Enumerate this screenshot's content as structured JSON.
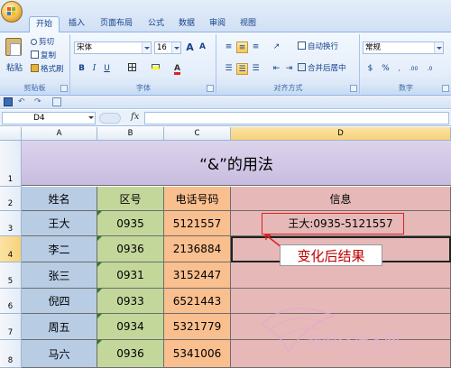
{
  "ribbon": {
    "tabs": [
      "开始",
      "插入",
      "页面布局",
      "公式",
      "数据",
      "审阅",
      "视图"
    ],
    "clipboard": {
      "paste": "粘贴",
      "cut": "剪切",
      "copy": "复制",
      "format_painter": "格式刷",
      "label": "剪贴板"
    },
    "font": {
      "name": "宋体",
      "size": "16",
      "grow": "A",
      "shrink": "A",
      "bold": "B",
      "italic": "I",
      "underline": "U",
      "label": "字体"
    },
    "alignment": {
      "wrap_text": "自动换行",
      "merge_center": "合并后居中",
      "label": "对齐方式"
    },
    "number": {
      "format": "常规",
      "label": "数字"
    }
  },
  "formula_bar": {
    "cell_ref": "D4",
    "fx": "fx"
  },
  "sheet": {
    "columns": [
      "A",
      "B",
      "C",
      "D"
    ],
    "rows": [
      "1",
      "2",
      "3",
      "4",
      "5",
      "6",
      "7",
      "8"
    ],
    "title": "“&”的用法",
    "headers": [
      "姓名",
      "区号",
      "电话号码",
      "信息"
    ],
    "records": [
      {
        "name": "王大",
        "area": "0935",
        "phone": "5121557",
        "info": "王大:0935-5121557"
      },
      {
        "name": "李二",
        "area": "0936",
        "phone": "2136884",
        "info": ""
      },
      {
        "name": "张三",
        "area": "0931",
        "phone": "3152447",
        "info": ""
      },
      {
        "name": "倪四",
        "area": "0933",
        "phone": "6521443",
        "info": ""
      },
      {
        "name": "周五",
        "area": "0934",
        "phone": "5321779",
        "info": ""
      },
      {
        "name": "马六",
        "area": "0936",
        "phone": "5341006",
        "info": ""
      }
    ]
  },
  "annotation": {
    "label": "变化后结果"
  },
  "watermark": {
    "text": "我爱IT技术网",
    "sub": "www.52itjs.com"
  },
  "colors": {
    "col_a": "#b8cce4",
    "col_b": "#c4d79b",
    "col_c": "#fabf8f",
    "col_d": "#e6b9b8",
    "title_bg": "#d4cbe6",
    "annotation": "#e02020"
  }
}
